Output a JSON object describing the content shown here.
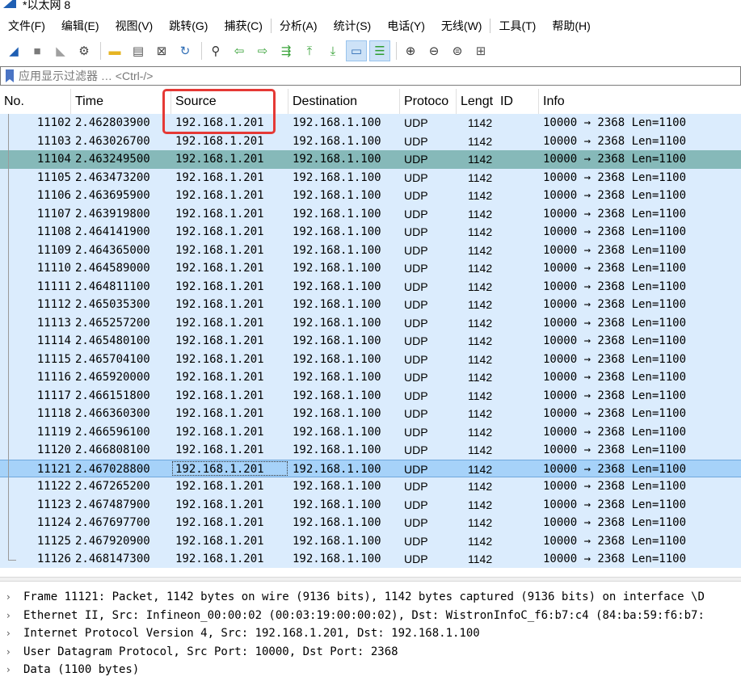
{
  "window": {
    "title": "*以太网 8"
  },
  "menu": [
    "文件(F)",
    "编辑(E)",
    "视图(V)",
    "跳转(G)",
    "捕获(C)",
    "分析(A)",
    "统计(S)",
    "电话(Y)",
    "无线(W)",
    "工具(T)",
    "帮助(H)"
  ],
  "toolbar": {
    "icons": [
      {
        "name": "shark-fin-start-icon",
        "glyph": "◢",
        "color": "#1f5fb3"
      },
      {
        "name": "stop-capture-icon",
        "glyph": "■",
        "color": "#7a7a7a"
      },
      {
        "name": "restart-capture-icon",
        "glyph": "◣",
        "color": "#a0a0a0"
      },
      {
        "name": "capture-options-icon",
        "glyph": "⚙",
        "color": "#444444"
      },
      {
        "name": "open-file-icon",
        "glyph": "▬",
        "color": "#e6b422"
      },
      {
        "name": "save-file-icon",
        "glyph": "▤",
        "color": "#555555"
      },
      {
        "name": "close-file-icon",
        "glyph": "⊠",
        "color": "#444444"
      },
      {
        "name": "reload-file-icon",
        "glyph": "↻",
        "color": "#2f6db5"
      },
      {
        "name": "find-packet-icon",
        "glyph": "⚲",
        "color": "#333333"
      },
      {
        "name": "go-back-icon",
        "glyph": "⇦",
        "color": "#3aa33a"
      },
      {
        "name": "go-forward-icon",
        "glyph": "⇨",
        "color": "#3aa33a"
      },
      {
        "name": "go-to-packet-icon",
        "glyph": "⇶",
        "color": "#3aa33a"
      },
      {
        "name": "go-first-icon",
        "glyph": "⤒",
        "color": "#3aa33a"
      },
      {
        "name": "go-last-icon",
        "glyph": "⤓",
        "color": "#3aa33a"
      },
      {
        "name": "auto-scroll-icon",
        "glyph": "▭",
        "color": "#2f6db5"
      },
      {
        "name": "colorize-icon",
        "glyph": "☰",
        "color": "#2f9d2f"
      },
      {
        "name": "zoom-in-icon",
        "glyph": "⊕",
        "color": "#333333"
      },
      {
        "name": "zoom-out-icon",
        "glyph": "⊖",
        "color": "#333333"
      },
      {
        "name": "zoom-reset-icon",
        "glyph": "⊜",
        "color": "#333333"
      },
      {
        "name": "resize-columns-icon",
        "glyph": "⊞",
        "color": "#555555"
      }
    ]
  },
  "filter": {
    "placeholder": "应用显示过滤器 … <Ctrl-/>"
  },
  "columns": {
    "no": "No.",
    "time": "Time",
    "source": "Source",
    "destination": "Destination",
    "protocol": "Protoco",
    "length": "Lengt",
    "id": "ID",
    "info": "Info"
  },
  "packets": [
    {
      "no": "11102",
      "time": "2.462803900",
      "src": "192.168.1.201",
      "dst": "192.168.1.100",
      "proto": "UDP",
      "len": "1142",
      "info": "10000 → 2368 Len=1100"
    },
    {
      "no": "11103",
      "time": "2.463026700",
      "src": "192.168.1.201",
      "dst": "192.168.1.100",
      "proto": "UDP",
      "len": "1142",
      "info": "10000 → 2368 Len=1100"
    },
    {
      "no": "11104",
      "time": "2.463249500",
      "src": "192.168.1.201",
      "dst": "192.168.1.100",
      "proto": "UDP",
      "len": "1142",
      "info": "10000 → 2368 Len=1100",
      "state": "marked"
    },
    {
      "no": "11105",
      "time": "2.463473200",
      "src": "192.168.1.201",
      "dst": "192.168.1.100",
      "proto": "UDP",
      "len": "1142",
      "info": "10000 → 2368 Len=1100"
    },
    {
      "no": "11106",
      "time": "2.463695900",
      "src": "192.168.1.201",
      "dst": "192.168.1.100",
      "proto": "UDP",
      "len": "1142",
      "info": "10000 → 2368 Len=1100"
    },
    {
      "no": "11107",
      "time": "2.463919800",
      "src": "192.168.1.201",
      "dst": "192.168.1.100",
      "proto": "UDP",
      "len": "1142",
      "info": "10000 → 2368 Len=1100"
    },
    {
      "no": "11108",
      "time": "2.464141900",
      "src": "192.168.1.201",
      "dst": "192.168.1.100",
      "proto": "UDP",
      "len": "1142",
      "info": "10000 → 2368 Len=1100"
    },
    {
      "no": "11109",
      "time": "2.464365000",
      "src": "192.168.1.201",
      "dst": "192.168.1.100",
      "proto": "UDP",
      "len": "1142",
      "info": "10000 → 2368 Len=1100"
    },
    {
      "no": "11110",
      "time": "2.464589000",
      "src": "192.168.1.201",
      "dst": "192.168.1.100",
      "proto": "UDP",
      "len": "1142",
      "info": "10000 → 2368 Len=1100"
    },
    {
      "no": "11111",
      "time": "2.464811100",
      "src": "192.168.1.201",
      "dst": "192.168.1.100",
      "proto": "UDP",
      "len": "1142",
      "info": "10000 → 2368 Len=1100"
    },
    {
      "no": "11112",
      "time": "2.465035300",
      "src": "192.168.1.201",
      "dst": "192.168.1.100",
      "proto": "UDP",
      "len": "1142",
      "info": "10000 → 2368 Len=1100"
    },
    {
      "no": "11113",
      "time": "2.465257200",
      "src": "192.168.1.201",
      "dst": "192.168.1.100",
      "proto": "UDP",
      "len": "1142",
      "info": "10000 → 2368 Len=1100"
    },
    {
      "no": "11114",
      "time": "2.465480100",
      "src": "192.168.1.201",
      "dst": "192.168.1.100",
      "proto": "UDP",
      "len": "1142",
      "info": "10000 → 2368 Len=1100"
    },
    {
      "no": "11115",
      "time": "2.465704100",
      "src": "192.168.1.201",
      "dst": "192.168.1.100",
      "proto": "UDP",
      "len": "1142",
      "info": "10000 → 2368 Len=1100"
    },
    {
      "no": "11116",
      "time": "2.465920000",
      "src": "192.168.1.201",
      "dst": "192.168.1.100",
      "proto": "UDP",
      "len": "1142",
      "info": "10000 → 2368 Len=1100"
    },
    {
      "no": "11117",
      "time": "2.466151800",
      "src": "192.168.1.201",
      "dst": "192.168.1.100",
      "proto": "UDP",
      "len": "1142",
      "info": "10000 → 2368 Len=1100"
    },
    {
      "no": "11118",
      "time": "2.466360300",
      "src": "192.168.1.201",
      "dst": "192.168.1.100",
      "proto": "UDP",
      "len": "1142",
      "info": "10000 → 2368 Len=1100"
    },
    {
      "no": "11119",
      "time": "2.466596100",
      "src": "192.168.1.201",
      "dst": "192.168.1.100",
      "proto": "UDP",
      "len": "1142",
      "info": "10000 → 2368 Len=1100"
    },
    {
      "no": "11120",
      "time": "2.466808100",
      "src": "192.168.1.201",
      "dst": "192.168.1.100",
      "proto": "UDP",
      "len": "1142",
      "info": "10000 → 2368 Len=1100"
    },
    {
      "no": "11121",
      "time": "2.467028800",
      "src": "192.168.1.201",
      "dst": "192.168.1.100",
      "proto": "UDP",
      "len": "1142",
      "info": "10000 → 2368 Len=1100",
      "state": "selected"
    },
    {
      "no": "11122",
      "time": "2.467265200",
      "src": "192.168.1.201",
      "dst": "192.168.1.100",
      "proto": "UDP",
      "len": "1142",
      "info": "10000 → 2368 Len=1100"
    },
    {
      "no": "11123",
      "time": "2.467487900",
      "src": "192.168.1.201",
      "dst": "192.168.1.100",
      "proto": "UDP",
      "len": "1142",
      "info": "10000 → 2368 Len=1100"
    },
    {
      "no": "11124",
      "time": "2.467697700",
      "src": "192.168.1.201",
      "dst": "192.168.1.100",
      "proto": "UDP",
      "len": "1142",
      "info": "10000 → 2368 Len=1100"
    },
    {
      "no": "11125",
      "time": "2.467920900",
      "src": "192.168.1.201",
      "dst": "192.168.1.100",
      "proto": "UDP",
      "len": "1142",
      "info": "10000 → 2368 Len=1100"
    },
    {
      "no": "11126",
      "time": "2.468147300",
      "src": "192.168.1.201",
      "dst": "192.168.1.100",
      "proto": "UDP",
      "len": "1142",
      "info": "10000 → 2368 Len=1100"
    }
  ],
  "details": [
    "Frame 11121: Packet, 1142 bytes on wire (9136 bits), 1142 bytes captured (9136 bits) on interface \\D",
    "Ethernet II, Src: Infineon_00:00:02 (00:03:19:00:00:02), Dst: WistronInfoC_f6:b7:c4 (84:ba:59:f6:b7:",
    "Internet Protocol Version 4, Src: 192.168.1.201, Dst: 192.168.1.100",
    "User Datagram Protocol, Src Port: 10000, Dst Port: 2368",
    "Data (1100 bytes)"
  ],
  "colors": {
    "row_bg": "#dbecfd",
    "marked_bg": "#86b9b9",
    "selected_bg": "#a6d2f9",
    "highlight_box": "#e53935"
  }
}
